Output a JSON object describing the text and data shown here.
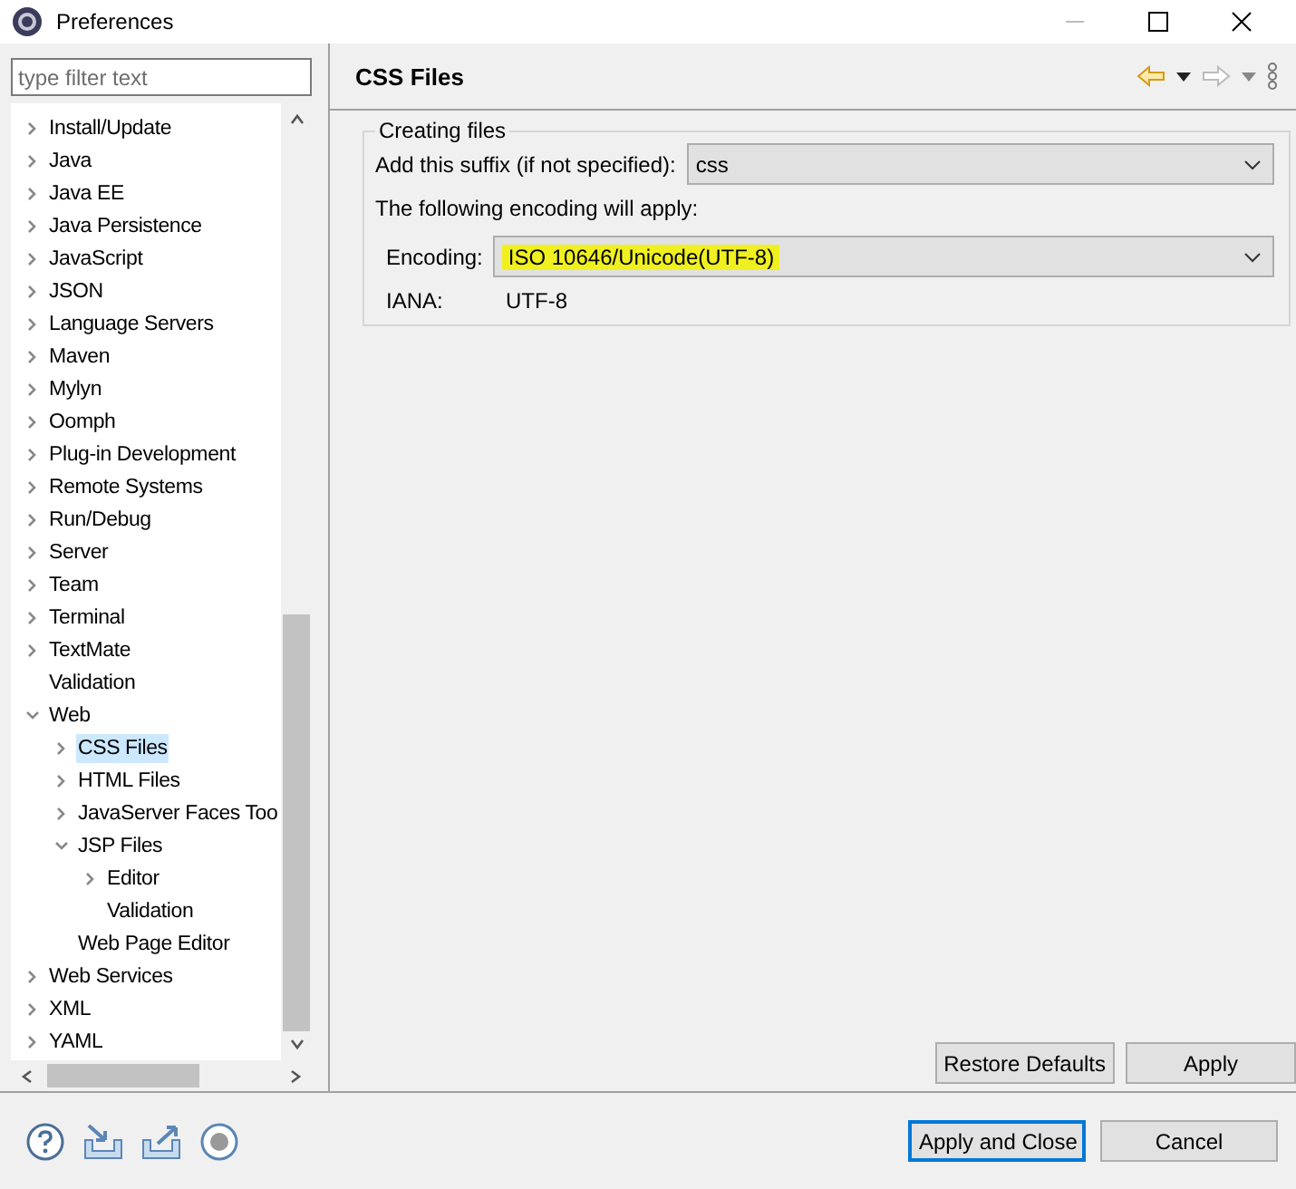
{
  "window": {
    "title": "Preferences"
  },
  "filter": {
    "placeholder": "type filter text"
  },
  "tree": [
    {
      "label": "Install/Update",
      "expanded": false,
      "selected": false
    },
    {
      "label": "Java",
      "expanded": false,
      "selected": false
    },
    {
      "label": "Java EE",
      "expanded": false,
      "selected": false
    },
    {
      "label": "Java Persistence",
      "expanded": false,
      "selected": false
    },
    {
      "label": "JavaScript",
      "expanded": false,
      "selected": false
    },
    {
      "label": "JSON",
      "expanded": false,
      "selected": false
    },
    {
      "label": "Language Servers",
      "expanded": false,
      "selected": false
    },
    {
      "label": "Maven",
      "expanded": false,
      "selected": false
    },
    {
      "label": "Mylyn",
      "expanded": false,
      "selected": false
    },
    {
      "label": "Oomph",
      "expanded": false,
      "selected": false
    },
    {
      "label": "Plug-in Development",
      "expanded": false,
      "selected": false
    },
    {
      "label": "Remote Systems",
      "expanded": false,
      "selected": false
    },
    {
      "label": "Run/Debug",
      "expanded": false,
      "selected": false
    },
    {
      "label": "Server",
      "expanded": false,
      "selected": false
    },
    {
      "label": "Team",
      "expanded": false,
      "selected": false
    },
    {
      "label": "Terminal",
      "expanded": false,
      "selected": false
    },
    {
      "label": "TextMate",
      "expanded": false,
      "selected": false
    },
    {
      "label": "Validation",
      "selected": false
    },
    {
      "label": "Web",
      "expanded": true,
      "selected": false,
      "children": [
        {
          "label": "CSS Files",
          "expanded": false,
          "selected": true
        },
        {
          "label": "HTML Files",
          "expanded": false,
          "selected": false
        },
        {
          "label": "JavaServer Faces Too",
          "expanded": false,
          "selected": false
        },
        {
          "label": "JSP Files",
          "expanded": true,
          "selected": false,
          "children": [
            {
              "label": "Editor",
              "expanded": false,
              "selected": false
            },
            {
              "label": "Validation",
              "selected": false
            }
          ]
        },
        {
          "label": "Web Page Editor",
          "selected": false
        }
      ]
    },
    {
      "label": "Web Services",
      "expanded": false,
      "selected": false
    },
    {
      "label": "XML",
      "expanded": false,
      "selected": false
    },
    {
      "label": "YAML",
      "expanded": false,
      "selected": false
    }
  ],
  "page": {
    "title": "CSS Files",
    "group": {
      "title": "Creating files",
      "suffix": {
        "label": "Add this suffix (if not specified):",
        "value": "css"
      },
      "note": "The following encoding will apply:",
      "encoding": {
        "label": "Encoding:",
        "value": "ISO 10646/Unicode(UTF-8)",
        "highlighted": true
      },
      "iana": {
        "label": "IANA:",
        "value": "UTF-8"
      }
    },
    "buttons": [
      "Restore Defaults",
      "Apply"
    ]
  },
  "footer_buttons": [
    {
      "label": "Apply and Close",
      "default": true
    },
    {
      "label": "Cancel",
      "default": false
    }
  ]
}
